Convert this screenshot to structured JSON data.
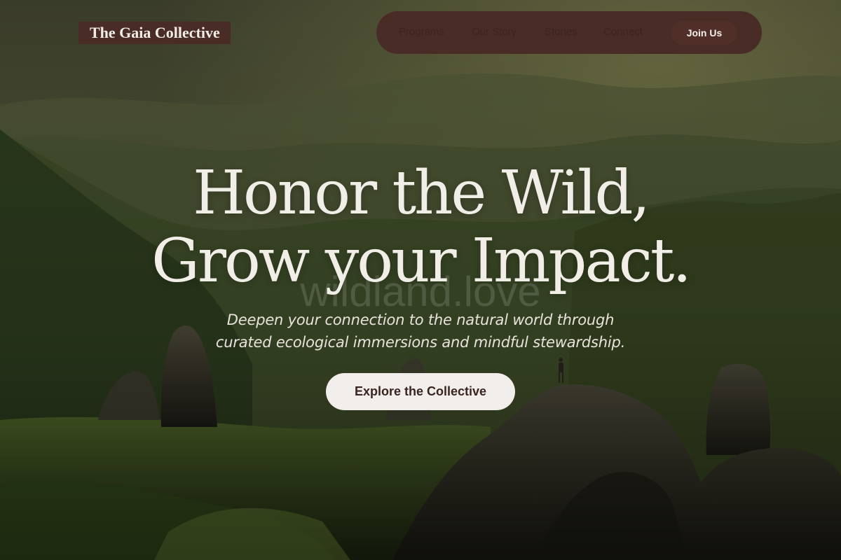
{
  "brand": {
    "name": "The Gaia Collective"
  },
  "nav": {
    "items": [
      {
        "label": "Programs"
      },
      {
        "label": "Our Story"
      },
      {
        "label": "Stories"
      },
      {
        "label": "Connect"
      }
    ],
    "join_label": "Join Us"
  },
  "hero": {
    "headline_line1": "Honor the Wild,",
    "headline_line2": "Grow your Impact.",
    "subtitle_line1": "Deepen your connection to the natural world through",
    "subtitle_line2": "curated ecological immersions and mindful stewardship.",
    "cta_label": "Explore the Collective",
    "watermark": "wildland.love"
  },
  "colors": {
    "accent": "#4a2c26",
    "cta_background": "#f2eeeb",
    "text_light": "#f1ede7"
  }
}
